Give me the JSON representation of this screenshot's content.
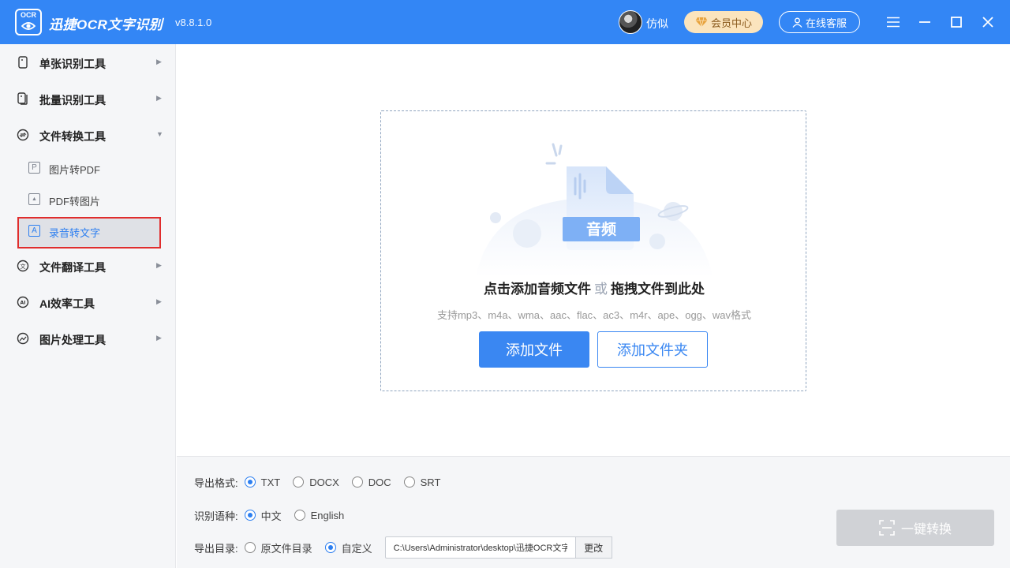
{
  "header": {
    "logo_text": "OCR",
    "app_name": "迅捷OCR文字识别",
    "version": "v8.8.1.0",
    "username": "仿似",
    "vip_label": "会员中心",
    "service_label": "在线客服",
    "brand_color": "#3386f5"
  },
  "sidebar": {
    "categories": [
      {
        "label": "单张识别工具",
        "icon": "single-file-icon"
      },
      {
        "label": "批量识别工具",
        "icon": "batch-file-icon"
      },
      {
        "label": "文件转换工具",
        "icon": "convert-icon",
        "expanded": true
      },
      {
        "label": "文件翻译工具",
        "icon": "translate-icon"
      },
      {
        "label": "AI效率工具",
        "icon": "ai-icon"
      },
      {
        "label": "图片处理工具",
        "icon": "image-process-icon"
      }
    ],
    "sub_items": [
      {
        "label": "图片转PDF",
        "icon_glyph": "P"
      },
      {
        "label": "PDF转图片",
        "icon_glyph": "▲"
      },
      {
        "label": "录音转文字",
        "icon_glyph": "A",
        "active": true
      }
    ]
  },
  "dropzone": {
    "badge": "音频",
    "title_main": "点击添加音频文件",
    "title_or": "或",
    "title_drag": "拖拽文件到此处",
    "hint": "支持mp3、m4a、wma、aac、flac、ac3、m4r、ape、ogg、wav格式",
    "add_file": "添加文件",
    "add_folder": "添加文件夹"
  },
  "settings": {
    "format_label": "导出格式:",
    "formats": [
      "TXT",
      "DOCX",
      "DOC",
      "SRT"
    ],
    "selected_format": "TXT",
    "lang_label": "识别语种:",
    "languages": [
      "中文",
      "English"
    ],
    "selected_language": "中文",
    "dir_label": "导出目录:",
    "dir_options": [
      "原文件目录",
      "自定义"
    ],
    "selected_dir": "自定义",
    "path": "C:\\Users\\Administrator\\desktop\\迅捷OCR文字识别",
    "change_label": "更改",
    "convert_label": "一键转换"
  }
}
